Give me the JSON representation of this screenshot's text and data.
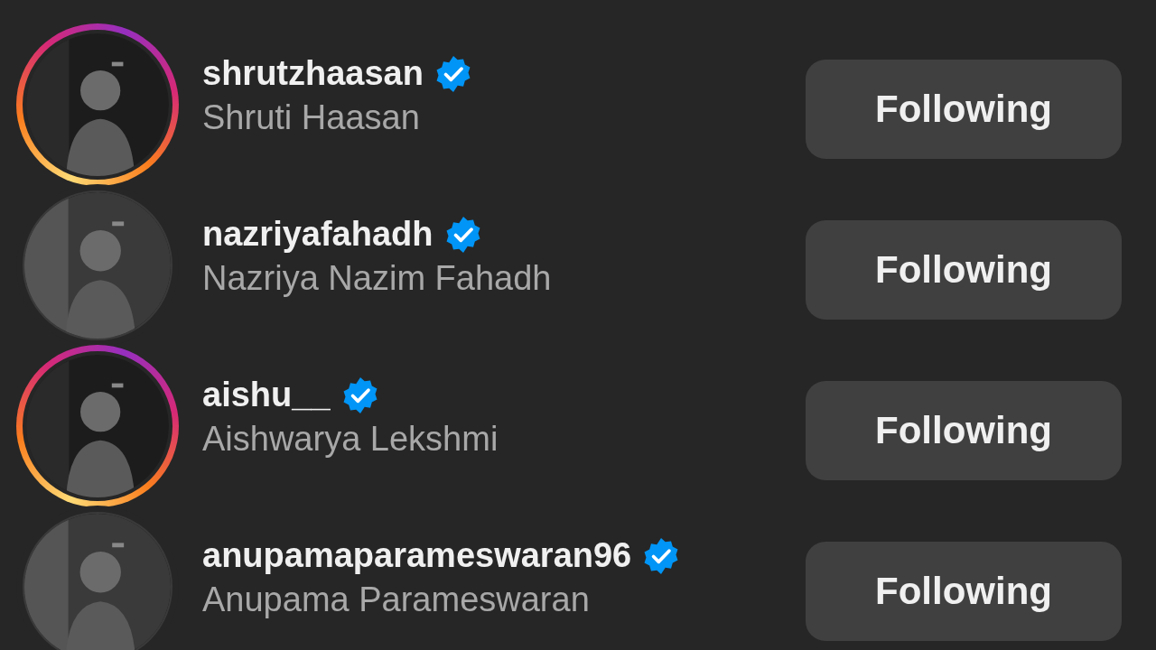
{
  "accounts": [
    {
      "username": "shrutzhaasan",
      "verified": true,
      "name": "Shruti Haasan",
      "story_ring": true,
      "button": "Following"
    },
    {
      "username": "nazriyafahadh",
      "verified": true,
      "name": "Nazriya Nazim Fahadh",
      "story_ring": false,
      "button": "Following"
    },
    {
      "username": "aishu__",
      "verified": true,
      "name": "Aishwarya Lekshmi",
      "story_ring": true,
      "button": "Following"
    },
    {
      "username": "anupamaparameswaran96",
      "verified": true,
      "name": "Anupama Parameswaran",
      "story_ring": false,
      "button": "Following"
    }
  ]
}
